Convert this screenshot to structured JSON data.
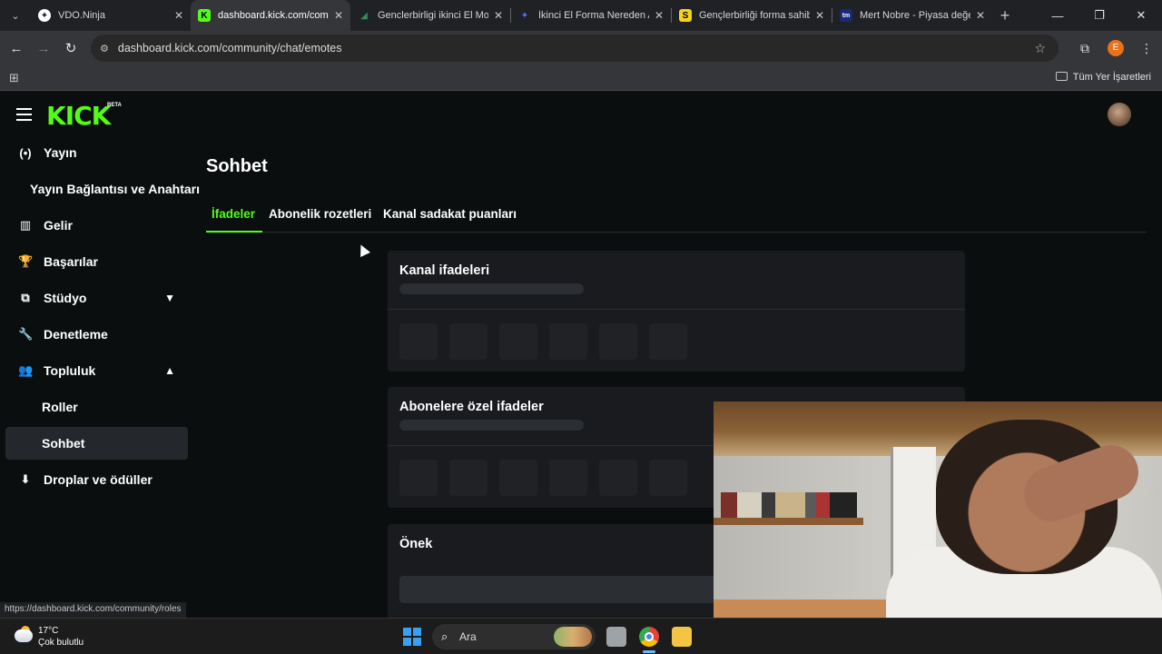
{
  "browser": {
    "tabs": [
      {
        "title": "VDO.Ninja",
        "fav_color": "#ffffff",
        "fav_text": "✦"
      },
      {
        "title": "dashboard.kick.com/comm",
        "fav_color": "#53fc18",
        "fav_text": "K"
      },
      {
        "title": "Genclerbirligi ikinci El Mod",
        "fav_color": "#2d8f5a",
        "fav_text": "◢"
      },
      {
        "title": "İkinci El Forma Nereden Al",
        "fav_color": "#4a7ce8",
        "fav_text": "✦"
      },
      {
        "title": "Gençlerbirliği forma sahibi",
        "fav_color": "#f6d31a",
        "fav_text": "S"
      },
      {
        "title": "Mert Nobre - Piyasa değe",
        "fav_color": "#1a2a7a",
        "fav_text": "tm"
      }
    ],
    "url": "dashboard.kick.com/community/chat/emotes",
    "profile_initial": "E",
    "bookmarks_all": "Tüm Yer İşaretleri",
    "status_url": "https://dashboard.kick.com/community/roles"
  },
  "kick": {
    "logo": "KICK",
    "beta": "BETA",
    "accent": "#53fc18",
    "sidebar": [
      {
        "label": "Yayın",
        "icon": "broadcast-icon",
        "glyph": "(•)"
      },
      {
        "label": "Yayın Bağlantısı ve Anahtarı",
        "icon": "",
        "glyph": ""
      },
      {
        "label": "Gelir",
        "icon": "revenue-icon",
        "glyph": "▥"
      },
      {
        "label": "Başarılar",
        "icon": "trophy-icon",
        "glyph": "🏆"
      },
      {
        "label": "Stüdyo",
        "icon": "studio-icon",
        "glyph": "⧉"
      },
      {
        "label": "Denetleme",
        "icon": "wrench-icon",
        "glyph": "🔧"
      },
      {
        "label": "Topluluk",
        "icon": "community-icon",
        "glyph": "👥"
      },
      {
        "label": "Roller",
        "icon": "",
        "glyph": ""
      },
      {
        "label": "Sohbet",
        "icon": "",
        "glyph": ""
      },
      {
        "label": "Droplar ve ödüller",
        "icon": "drops-icon",
        "glyph": "⬇"
      }
    ],
    "page_title": "Sohbet",
    "tabs": [
      "İfadeler",
      "Abonelik rozetleri",
      "Kanal sadakat puanları"
    ],
    "cards": {
      "channel_emotes": "Kanal ifadeleri",
      "subscriber_emotes": "Abonelere özel ifadeler",
      "prefix": "Önek"
    }
  },
  "taskbar": {
    "temp": "17°C",
    "weather": "Çok bulutlu",
    "search": "Ara"
  }
}
